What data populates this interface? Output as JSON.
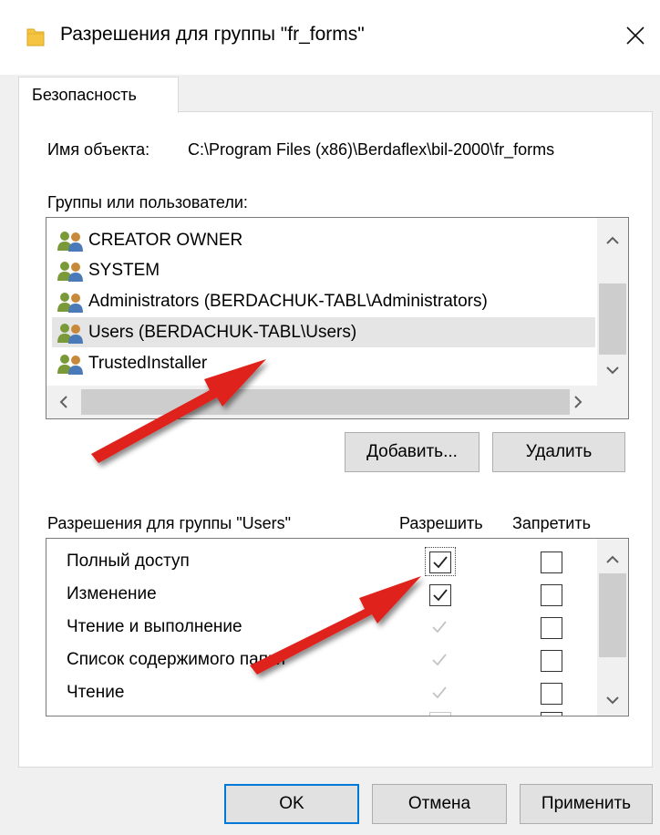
{
  "window": {
    "title": "Разрешения для группы \"fr_forms\""
  },
  "tabs": [
    {
      "label": "Безопасность",
      "active": true
    }
  ],
  "object": {
    "label": "Имя объекта:",
    "path": "C:\\Program Files (x86)\\Berdaflex\\bil-2000\\fr_forms"
  },
  "groups": {
    "label": "Группы или пользователи:",
    "items": [
      {
        "name": "CREATOR OWNER",
        "icon": "users-icon",
        "selected": false
      },
      {
        "name": "SYSTEM",
        "icon": "users-icon",
        "selected": false
      },
      {
        "name": "Administrators (BERDACHUK-TABL\\Administrators)",
        "icon": "users-icon",
        "selected": false
      },
      {
        "name": "Users (BERDACHUK-TABL\\Users)",
        "icon": "users-icon",
        "selected": true
      },
      {
        "name": "TrustedInstaller",
        "icon": "users-icon",
        "selected": false
      }
    ]
  },
  "buttons": {
    "add": "Добавить...",
    "remove": "Удалить",
    "ok": "OK",
    "cancel": "Отмена",
    "apply": "Применить"
  },
  "permissions": {
    "label": "Разрешения для группы \"Users\"",
    "allow_header": "Разрешить",
    "deny_header": "Запретить",
    "rows": [
      {
        "name": "Полный доступ",
        "allow": true,
        "allow_enabled": true,
        "deny": false
      },
      {
        "name": "Изменение",
        "allow": true,
        "allow_enabled": true,
        "deny": false
      },
      {
        "name": "Чтение и выполнение",
        "allow": true,
        "allow_enabled": false,
        "deny": false
      },
      {
        "name": "Список содержимого папки",
        "allow": true,
        "allow_enabled": false,
        "deny": false
      },
      {
        "name": "Чтение",
        "allow": true,
        "allow_enabled": false,
        "deny": false
      }
    ]
  },
  "colors": {
    "accent": "#0078d7",
    "annotation_arrow": "#e0201a"
  }
}
